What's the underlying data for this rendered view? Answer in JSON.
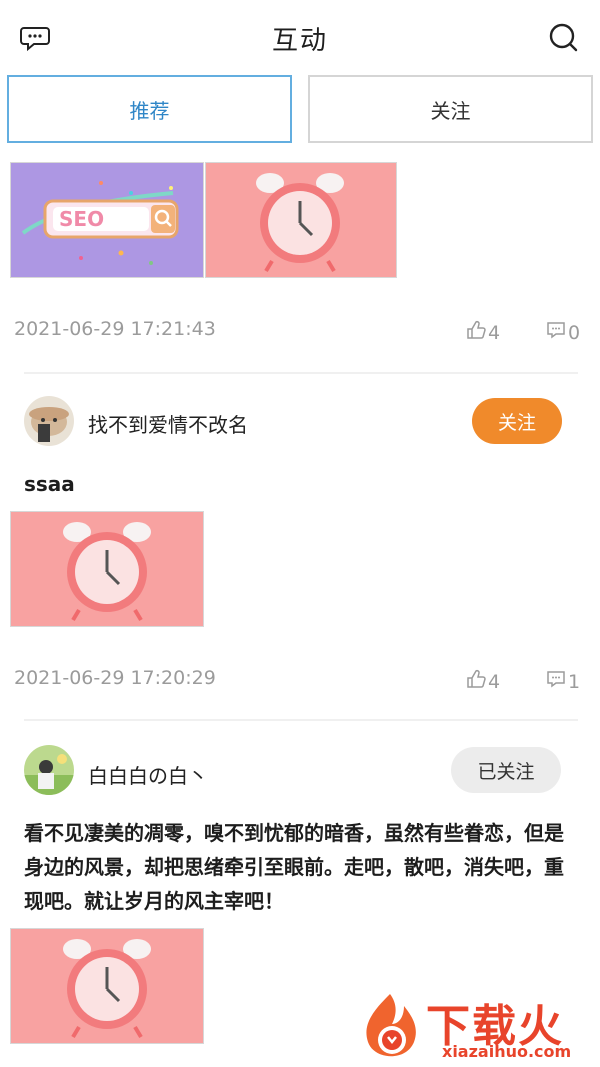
{
  "header": {
    "title": "互动",
    "left_icon": "chat-bubble-icon",
    "right_icon": "search-icon"
  },
  "tabs": [
    {
      "label": "推荐",
      "active": true
    },
    {
      "label": "关注",
      "active": false
    }
  ],
  "posts": [
    {
      "images": [
        {
          "image": "seo-search-illustration",
          "label": "SEO"
        },
        {
          "image": "alarm-clock-illustration"
        }
      ],
      "time": "2021-06-29 17:21:43",
      "likes": "4",
      "comments": "0"
    },
    {
      "username": "找不到爱情不改名",
      "follow_label": "关注",
      "text": "ssaa",
      "images": [
        {
          "image": "alarm-clock-illustration"
        }
      ],
      "time": "2021-06-29 17:20:29",
      "likes": "4",
      "comments": "1"
    },
    {
      "username": "白白白の白丶",
      "follow_label": "已关注",
      "text": "看不见凄美的凋零，嗅不到忧郁的暗香，虽然有些眷恋，但是身边的风景，却把思绪牵引至眼前。走吧，散吧，消失吧，重现吧。就让岁月的风主宰吧！",
      "images": [
        {
          "image": "alarm-clock-illustration"
        }
      ]
    }
  ],
  "watermark": {
    "brand": "下载火",
    "url": "xiazaihuo.com"
  },
  "colors": {
    "accent_blue": "#2f86c7",
    "follow_orange": "#f08a2b",
    "muted_gray": "#9b9b9b",
    "clock_bg": "#f9a3a2",
    "seo_bg": "#b19be6"
  }
}
